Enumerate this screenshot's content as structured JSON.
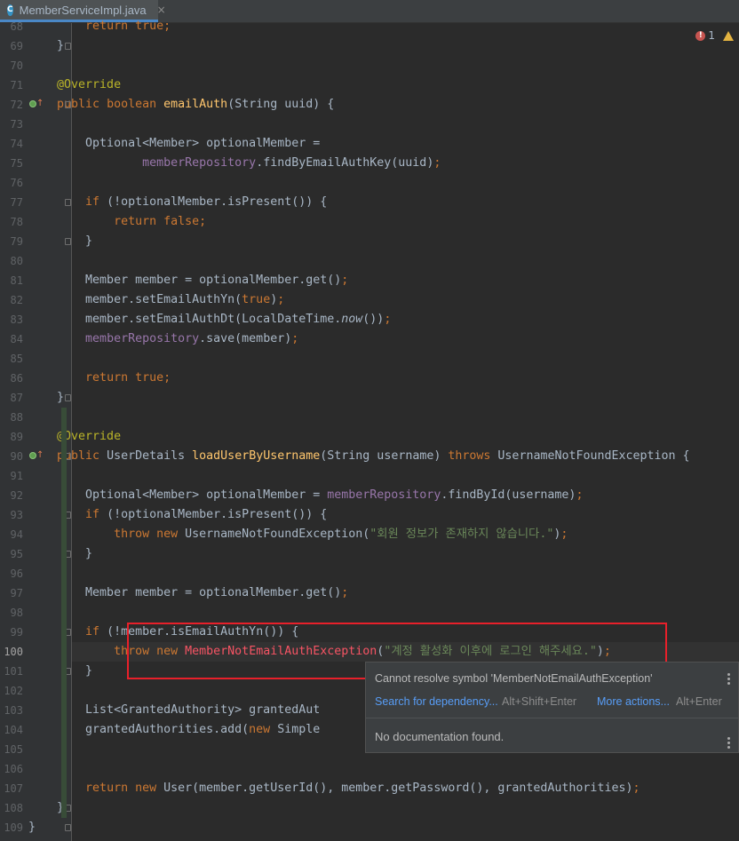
{
  "tab": {
    "icon": "C",
    "filename": "MemberServiceImpl.java",
    "close": "×"
  },
  "problems": {
    "errors": "1"
  },
  "lines": [
    {
      "n": "68",
      "segs": [
        [
          "    ",
          ""
        ],
        [
          "    return true;",
          "kw"
        ]
      ]
    },
    {
      "n": "69",
      "segs": [
        [
          "    }",
          ""
        ]
      ]
    },
    {
      "n": "70",
      "segs": []
    },
    {
      "n": "71",
      "segs": [
        [
          "    @Override",
          "an"
        ]
      ]
    },
    {
      "n": "72",
      "segs": [
        [
          "    ",
          ""
        ],
        [
          "public boolean ",
          "kw"
        ],
        [
          "emailAuth",
          "fn"
        ],
        [
          "(String uuid) {",
          ""
        ]
      ]
    },
    {
      "n": "73",
      "segs": []
    },
    {
      "n": "74",
      "segs": [
        [
          "        Optional<Member> optionalMember =",
          ""
        ]
      ]
    },
    {
      "n": "75",
      "segs": [
        [
          "                ",
          ""
        ],
        [
          "memberRepository",
          "fld"
        ],
        [
          ".findByEmailAuthKey(uuid)",
          ""
        ],
        [
          ";",
          "kw"
        ]
      ]
    },
    {
      "n": "76",
      "segs": []
    },
    {
      "n": "77",
      "segs": [
        [
          "        ",
          ""
        ],
        [
          "if ",
          "kw"
        ],
        [
          "(!optionalMember.isPresent()) {",
          ""
        ]
      ]
    },
    {
      "n": "78",
      "segs": [
        [
          "            ",
          ""
        ],
        [
          "return false;",
          "kw"
        ]
      ]
    },
    {
      "n": "79",
      "segs": [
        [
          "        }",
          ""
        ]
      ]
    },
    {
      "n": "80",
      "segs": []
    },
    {
      "n": "81",
      "segs": [
        [
          "        Member member = optionalMember.get()",
          ""
        ],
        [
          ";",
          "kw"
        ]
      ]
    },
    {
      "n": "82",
      "segs": [
        [
          "        member.setEmailAuthYn(",
          ""
        ],
        [
          "true",
          "kw"
        ],
        [
          ")",
          ""
        ],
        [
          ";",
          "kw"
        ]
      ]
    },
    {
      "n": "83",
      "segs": [
        [
          "        member.setEmailAuthDt(LocalDateTime.",
          ""
        ],
        [
          "now",
          "it"
        ],
        [
          "())",
          ""
        ],
        [
          ";",
          "kw"
        ]
      ]
    },
    {
      "n": "84",
      "segs": [
        [
          "        ",
          ""
        ],
        [
          "memberRepository",
          "fld"
        ],
        [
          ".save(member)",
          ""
        ],
        [
          ";",
          "kw"
        ]
      ]
    },
    {
      "n": "85",
      "segs": []
    },
    {
      "n": "86",
      "segs": [
        [
          "        ",
          ""
        ],
        [
          "return true;",
          "kw"
        ]
      ]
    },
    {
      "n": "87",
      "segs": [
        [
          "    }",
          ""
        ]
      ]
    },
    {
      "n": "88",
      "segs": []
    },
    {
      "n": "89",
      "segs": [
        [
          "    @Override",
          "an"
        ]
      ]
    },
    {
      "n": "90",
      "segs": [
        [
          "    ",
          ""
        ],
        [
          "public ",
          "kw"
        ],
        [
          "UserDetails ",
          ""
        ],
        [
          "loadUserByUsername",
          "fn"
        ],
        [
          "(String username) ",
          ""
        ],
        [
          "throws ",
          "kw"
        ],
        [
          "UsernameNotFoundException {",
          ""
        ]
      ]
    },
    {
      "n": "91",
      "segs": []
    },
    {
      "n": "92",
      "segs": [
        [
          "        Optional<Member> optionalMember = ",
          ""
        ],
        [
          "memberRepository",
          "fld"
        ],
        [
          ".findById(username)",
          ""
        ],
        [
          ";",
          "kw"
        ]
      ]
    },
    {
      "n": "93",
      "segs": [
        [
          "        ",
          ""
        ],
        [
          "if ",
          "kw"
        ],
        [
          "(!optionalMember.isPresent()) {",
          ""
        ]
      ]
    },
    {
      "n": "94",
      "segs": [
        [
          "            ",
          ""
        ],
        [
          "throw new ",
          "kw"
        ],
        [
          "UsernameNotFoundException(",
          ""
        ],
        [
          "\"회원 정보가 존재하지 않습니다.\"",
          "st"
        ],
        [
          ")",
          ""
        ],
        [
          ";",
          "kw"
        ]
      ]
    },
    {
      "n": "95",
      "segs": [
        [
          "        }",
          ""
        ]
      ]
    },
    {
      "n": "96",
      "segs": []
    },
    {
      "n": "97",
      "segs": [
        [
          "        Member member = optionalMember.get()",
          ""
        ],
        [
          ";",
          "kw"
        ]
      ]
    },
    {
      "n": "98",
      "segs": []
    },
    {
      "n": "99",
      "segs": [
        [
          "        ",
          ""
        ],
        [
          "if ",
          "kw"
        ],
        [
          "(!member.isEmailAuthYn()) {",
          ""
        ]
      ]
    },
    {
      "n": "100",
      "segs": [
        [
          "            ",
          ""
        ],
        [
          "throw new ",
          "kw"
        ],
        [
          "MemberNotEmailAuthException",
          "err"
        ],
        [
          "(",
          ""
        ],
        [
          "\"계정 활성화 이후에 로그인 해주세요.\"",
          "st"
        ],
        [
          ")",
          ""
        ],
        [
          ";",
          "kw"
        ]
      ]
    },
    {
      "n": "101",
      "segs": [
        [
          "        }",
          ""
        ]
      ]
    },
    {
      "n": "102",
      "segs": []
    },
    {
      "n": "103",
      "segs": [
        [
          "        List<GrantedAuthority> grantedAut",
          ""
        ]
      ]
    },
    {
      "n": "104",
      "segs": [
        [
          "        grantedAuthorities.add(",
          ""
        ],
        [
          "new ",
          "kw"
        ],
        [
          "Simple",
          ""
        ]
      ]
    },
    {
      "n": "105",
      "segs": []
    },
    {
      "n": "106",
      "segs": []
    },
    {
      "n": "107",
      "segs": [
        [
          "        ",
          ""
        ],
        [
          "return new ",
          "kw"
        ],
        [
          "User(member.getUserId(), member.getPassword(), grantedAuthorities)",
          ""
        ],
        [
          ";",
          "kw"
        ]
      ]
    },
    {
      "n": "108",
      "segs": [
        [
          "    }",
          ""
        ]
      ]
    },
    {
      "n": "109",
      "segs": [
        [
          "}",
          ""
        ]
      ]
    }
  ],
  "popup": {
    "message": "Cannot resolve symbol 'MemberNotEmailAuthException'",
    "action1": "Search for dependency...",
    "shortcut1": "Alt+Shift+Enter",
    "action2": "More actions...",
    "shortcut2": "Alt+Enter",
    "nodoc": "No documentation found."
  },
  "colors": {
    "background": "#2b2b2b",
    "keyword": "#cc7832",
    "annotation": "#bbb529",
    "method": "#ffc66d",
    "field": "#9876aa",
    "string": "#6a8759",
    "error": "#f75464",
    "highlight_box": "#e8202a"
  }
}
